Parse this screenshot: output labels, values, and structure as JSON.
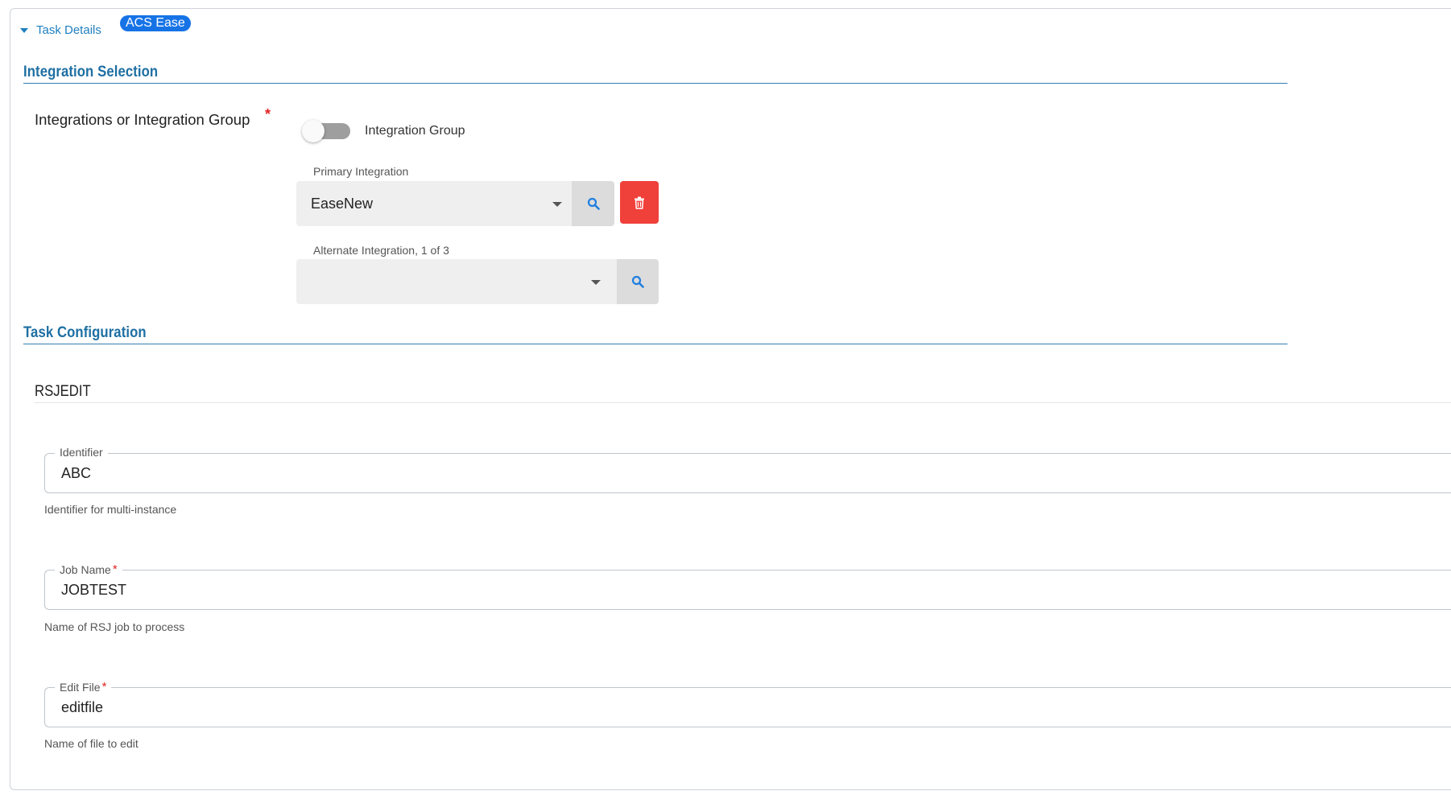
{
  "header": {
    "task_details_label": "Task Details",
    "badge": "ACS Ease"
  },
  "integration_selection": {
    "title": "Integration Selection",
    "label": "Integrations or Integration Group",
    "required_marker": "*",
    "toggle": {
      "label": "Integration Group",
      "on": false
    },
    "primary": {
      "caption": "Primary Integration",
      "value": "EaseNew"
    },
    "alternate": {
      "caption": "Alternate Integration, 1 of 3",
      "value": ""
    }
  },
  "task_configuration": {
    "title": "Task Configuration",
    "group_title": "RSJEDIT",
    "fields": [
      {
        "label": "Identifier",
        "required": false,
        "value": "ABC",
        "hint": "Identifier for multi-instance"
      },
      {
        "label": "Job Name",
        "required": true,
        "value": "JOBTEST",
        "hint": "Name of RSJ job to process"
      },
      {
        "label": "Edit File",
        "required": true,
        "value": "editfile",
        "hint": "Name of file to edit"
      }
    ]
  },
  "colors": {
    "accent": "#1f7fc0",
    "badge": "#1673e6",
    "delete": "#f0403a",
    "required": "#e02424"
  },
  "icons": {
    "caret": "caret-down-icon",
    "search": "search-icon",
    "delete": "trash-icon",
    "dropdown": "chevron-down-icon"
  }
}
